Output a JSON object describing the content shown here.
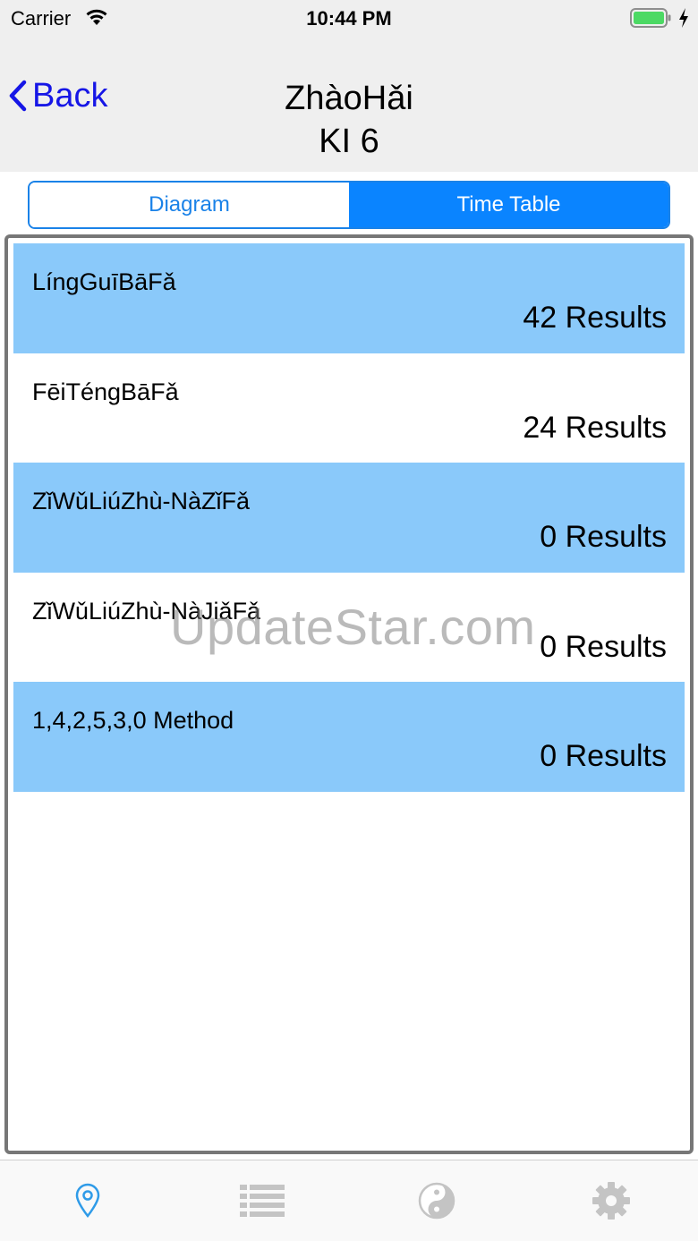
{
  "status_bar": {
    "carrier": "Carrier",
    "time": "10:44 PM",
    "icons": [
      "wifi-icon",
      "battery-icon",
      "charging-bolt-icon"
    ],
    "battery_color": "#4cd964"
  },
  "nav": {
    "back_label": "Back",
    "title_line1": "ZhàoHǎi",
    "title_line2": "KI 6",
    "back_icon": "chevron-left-icon",
    "accent_color": "#1616e6"
  },
  "segments": {
    "diagram": "Diagram",
    "time_table": "Time Table",
    "selected": "Time Table",
    "accent_color": "#0a84ff"
  },
  "results": {
    "highlight_color": "#8ac9fa",
    "items": [
      {
        "title": "LíngGuīBāFǎ",
        "count": "42 Results"
      },
      {
        "title": "FēiTéngBāFǎ",
        "count": "24 Results"
      },
      {
        "title": "ZǐWǔLiúZhù-NàZǐFǎ",
        "count": "0 Results"
      },
      {
        "title": "ZǐWǔLiúZhù-NàJiǎFǎ",
        "count": "0 Results"
      },
      {
        "title": "1,4,2,5,3,0 Method",
        "count": "0 Results"
      }
    ]
  },
  "watermark": "UpdateStar.com",
  "tab_bar": {
    "selected": "location-pin-icon",
    "tabs": [
      "location-pin-icon",
      "list-icon",
      "yin-yang-icon",
      "gear-icon"
    ]
  }
}
